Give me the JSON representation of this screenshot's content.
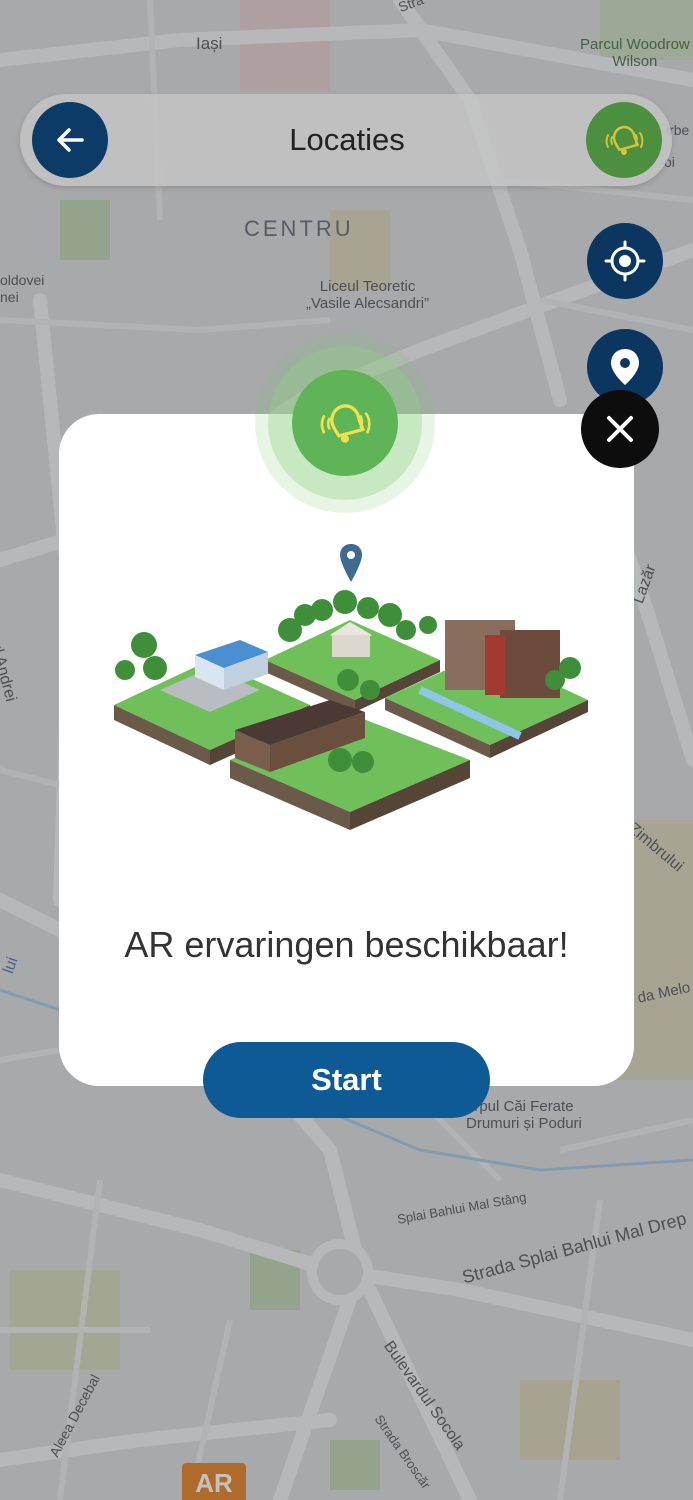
{
  "header": {
    "title": "Locaties"
  },
  "map": {
    "labels": {
      "iasi": "Iași",
      "parc": "Parcul Woodrow\nWilson",
      "centru": "CENTRU",
      "liceu": "Liceul Teoretic\n„Vasile Alecsandri”",
      "moldovei": "oldovei\nnei",
      "stefan": "Ștefantul Andrei",
      "lazar": "Lazăr",
      "zimbrului": "Zimbrului",
      "melo": "da Melo",
      "lui": "lui",
      "corpul": "rpul Căi Ferate\nDrumuri și Poduri",
      "splai1": "Splai Bahlui Mal Stâng",
      "splai2": "Strada Splai Bahlui Mal Drep",
      "socola": "Bulevardul Socola",
      "decebal": "Aleea Decebal",
      "broscar": "Strada Broscăr",
      "str": "Stra",
      "irbe": "irbe",
      "oi": "oi"
    },
    "ar_badge": "AR"
  },
  "modal": {
    "message": "AR ervaringen beschikbaar!",
    "start_label": "Start"
  },
  "colors": {
    "navy": "#0b3b66",
    "green": "#5fb458",
    "start": "#0d5a95",
    "ar_orange": "#e07a17"
  },
  "icons": {
    "back": "arrow-left-icon",
    "bell": "bell-ringing-icon",
    "locate": "crosshair-icon",
    "pin": "map-pin-icon",
    "close": "close-icon"
  }
}
